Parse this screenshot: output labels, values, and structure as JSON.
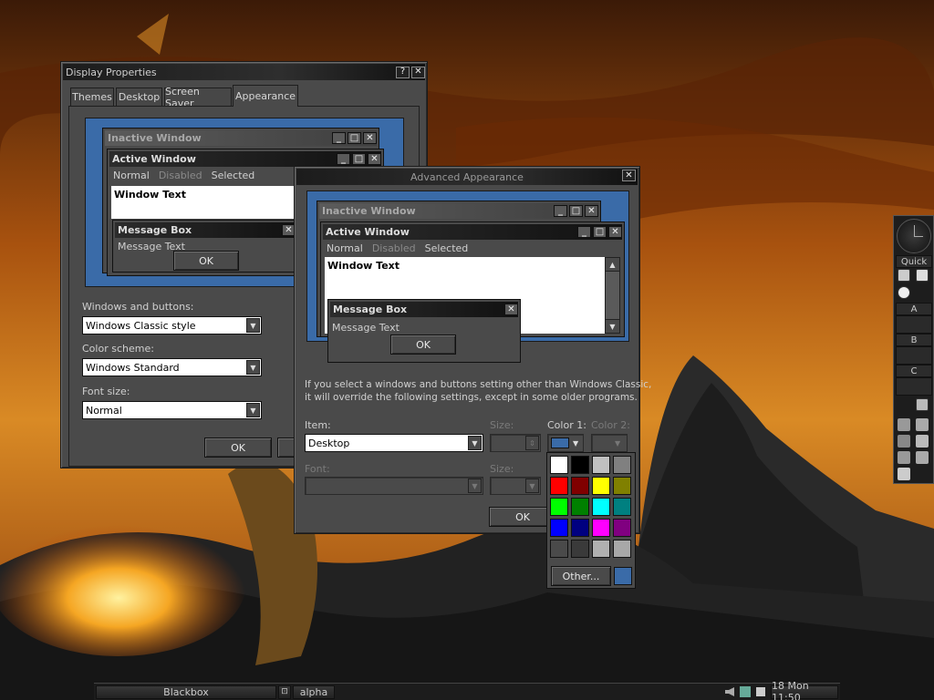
{
  "colors": {
    "window_face": "#4a4a4a",
    "titlebar_active": "#1c1c1c",
    "preview_desktop": "#3a6ba8",
    "selected_color": "#3a6ba8"
  },
  "display_properties": {
    "title": "Display Properties",
    "help_glyph": "?",
    "close_glyph": "✕",
    "tabs": [
      {
        "label": "Themes"
      },
      {
        "label": "Desktop"
      },
      {
        "label": "Screen Saver"
      },
      {
        "label": "Appearance"
      }
    ],
    "preview": {
      "inactive_title": "Inactive Window",
      "active_title": "Active Window",
      "menu_normal": "Normal",
      "menu_disabled": "Disabled",
      "menu_selected": "Selected",
      "window_text": "Window Text",
      "msgbox_title": "Message Box",
      "msgbox_text": "Message Text",
      "ok": "OK"
    },
    "windows_buttons_label": "Windows and buttons:",
    "windows_buttons_value": "Windows Classic style",
    "color_scheme_label": "Color scheme:",
    "color_scheme_value": "Windows Standard",
    "font_size_label": "Font size:",
    "font_size_value": "Normal",
    "ok": "OK"
  },
  "advanced_appearance": {
    "title": "Advanced Appearance",
    "close_glyph": "✕",
    "preview": {
      "inactive_title": "Inactive Window",
      "active_title": "Active Window",
      "menu_normal": "Normal",
      "menu_disabled": "Disabled",
      "menu_selected": "Selected",
      "window_text": "Window Text",
      "msgbox_title": "Message Box",
      "msgbox_text": "Message Text",
      "ok": "OK"
    },
    "note_line1": "If you select a windows and buttons setting other than Windows Classic,",
    "note_line2": "it will override the following settings, except in some older programs.",
    "item_label": "Item:",
    "item_value": "Desktop",
    "size_label": "Size:",
    "color1_label": "Color 1:",
    "color2_label": "Color 2:",
    "font_label": "Font:",
    "font_size_label": "Size:",
    "ok": "OK"
  },
  "color_picker": {
    "swatches": [
      [
        "#ffffff",
        "#000000",
        "#c0c0c0",
        "#808080"
      ],
      [
        "#ff0000",
        "#800000",
        "#ffff00",
        "#808000"
      ],
      [
        "#00ff00",
        "#008000",
        "#00ffff",
        "#008080"
      ],
      [
        "#0000ff",
        "#000080",
        "#ff00ff",
        "#800080"
      ],
      [
        "#4a4a4a",
        "#3a3a3a",
        "#b0b0b0",
        "#a8a8a8"
      ]
    ],
    "other_label": "Other...",
    "current_color": "#3a6ba8"
  },
  "slit": {
    "quick_label": "Quick",
    "labels": [
      "A",
      "B",
      "C"
    ]
  },
  "toolbar": {
    "workspace": "Blackbox",
    "window": "alpha",
    "clock": "18 Mon 11:50"
  }
}
